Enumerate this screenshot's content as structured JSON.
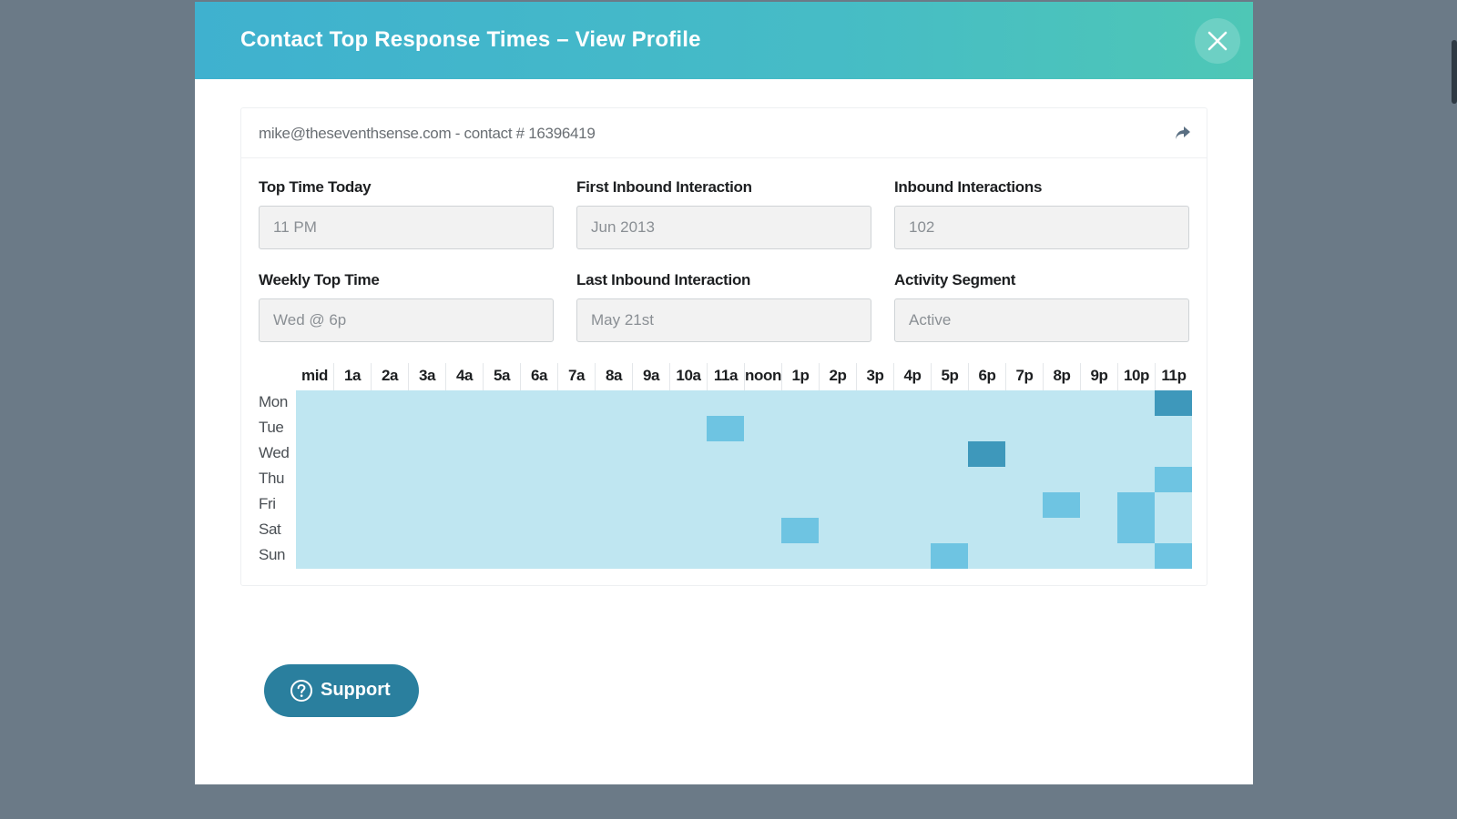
{
  "modal": {
    "title": "Contact Top Response Times – View Profile"
  },
  "contact": {
    "line": "mike@theseventhsense.com - contact # 16396419"
  },
  "fields": [
    {
      "label": "Top Time Today",
      "value": "11 PM"
    },
    {
      "label": "First Inbound Interaction",
      "value": "Jun 2013"
    },
    {
      "label": "Inbound Interactions",
      "value": "102"
    },
    {
      "label": "Weekly Top Time",
      "value": "Wed @ 6p"
    },
    {
      "label": "Last Inbound Interaction",
      "value": "May 21st"
    },
    {
      "label": "Activity Segment",
      "value": "Active"
    }
  ],
  "heatmap": {
    "hours": [
      "mid",
      "1a",
      "2a",
      "3a",
      "4a",
      "5a",
      "6a",
      "7a",
      "8a",
      "9a",
      "10a",
      "11a",
      "noon",
      "1p",
      "2p",
      "3p",
      "4p",
      "5p",
      "6p",
      "7p",
      "8p",
      "9p",
      "10p",
      "11p"
    ],
    "days": [
      "Mon",
      "Tue",
      "Wed",
      "Thu",
      "Fri",
      "Sat",
      "Sun"
    ],
    "levels": [
      [
        0,
        0,
        0,
        0,
        0,
        0,
        0,
        0,
        0,
        0,
        0,
        0,
        0,
        0,
        0,
        0,
        0,
        0,
        0,
        0,
        0,
        0,
        0,
        2
      ],
      [
        0,
        0,
        0,
        0,
        0,
        0,
        0,
        0,
        0,
        0,
        0,
        1,
        0,
        0,
        0,
        0,
        0,
        0,
        0,
        0,
        0,
        0,
        0,
        0
      ],
      [
        0,
        0,
        0,
        0,
        0,
        0,
        0,
        0,
        0,
        0,
        0,
        0,
        0,
        0,
        0,
        0,
        0,
        0,
        2,
        0,
        0,
        0,
        0,
        0
      ],
      [
        0,
        0,
        0,
        0,
        0,
        0,
        0,
        0,
        0,
        0,
        0,
        0,
        0,
        0,
        0,
        0,
        0,
        0,
        0,
        0,
        0,
        0,
        0,
        1
      ],
      [
        0,
        0,
        0,
        0,
        0,
        0,
        0,
        0,
        0,
        0,
        0,
        0,
        0,
        0,
        0,
        0,
        0,
        0,
        0,
        0,
        1,
        0,
        1,
        0
      ],
      [
        0,
        0,
        0,
        0,
        0,
        0,
        0,
        0,
        0,
        0,
        0,
        0,
        0,
        1,
        0,
        0,
        0,
        0,
        0,
        0,
        0,
        0,
        1,
        0
      ],
      [
        0,
        0,
        0,
        0,
        0,
        0,
        0,
        0,
        0,
        0,
        0,
        0,
        0,
        0,
        0,
        0,
        0,
        1,
        0,
        0,
        0,
        0,
        0,
        1
      ]
    ],
    "colors": [
      "#bfe6f1",
      "#6ec4e2",
      "#3e98bb"
    ]
  },
  "support": {
    "label": "Support"
  },
  "icons": {
    "close": "close-icon",
    "share": "share-icon",
    "help": "question-circle-icon"
  }
}
